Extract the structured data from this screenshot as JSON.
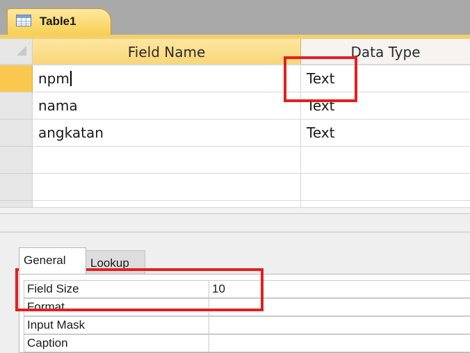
{
  "window": {
    "tab_title": "Table1",
    "icons": [
      "table-icon"
    ]
  },
  "design_grid": {
    "columns": [
      "Field Name",
      "Data Type"
    ],
    "rows": [
      {
        "field_name": "npm",
        "data_type": "Text",
        "selected": true
      },
      {
        "field_name": "nama",
        "data_type": "Text"
      },
      {
        "field_name": "angkatan",
        "data_type": "Text"
      },
      {
        "field_name": "",
        "data_type": ""
      },
      {
        "field_name": "",
        "data_type": ""
      },
      {
        "field_name": "",
        "data_type": ""
      }
    ]
  },
  "properties": {
    "tabs": [
      "General",
      "Lookup"
    ],
    "active_tab": "General",
    "rows": [
      {
        "label": "Field Size",
        "value": "10"
      },
      {
        "label": "Format",
        "value": ""
      },
      {
        "label": "Input Mask",
        "value": ""
      },
      {
        "label": "Caption",
        "value": ""
      }
    ]
  },
  "highlight_color": "#e02020",
  "active_accent": "#fbc84f"
}
